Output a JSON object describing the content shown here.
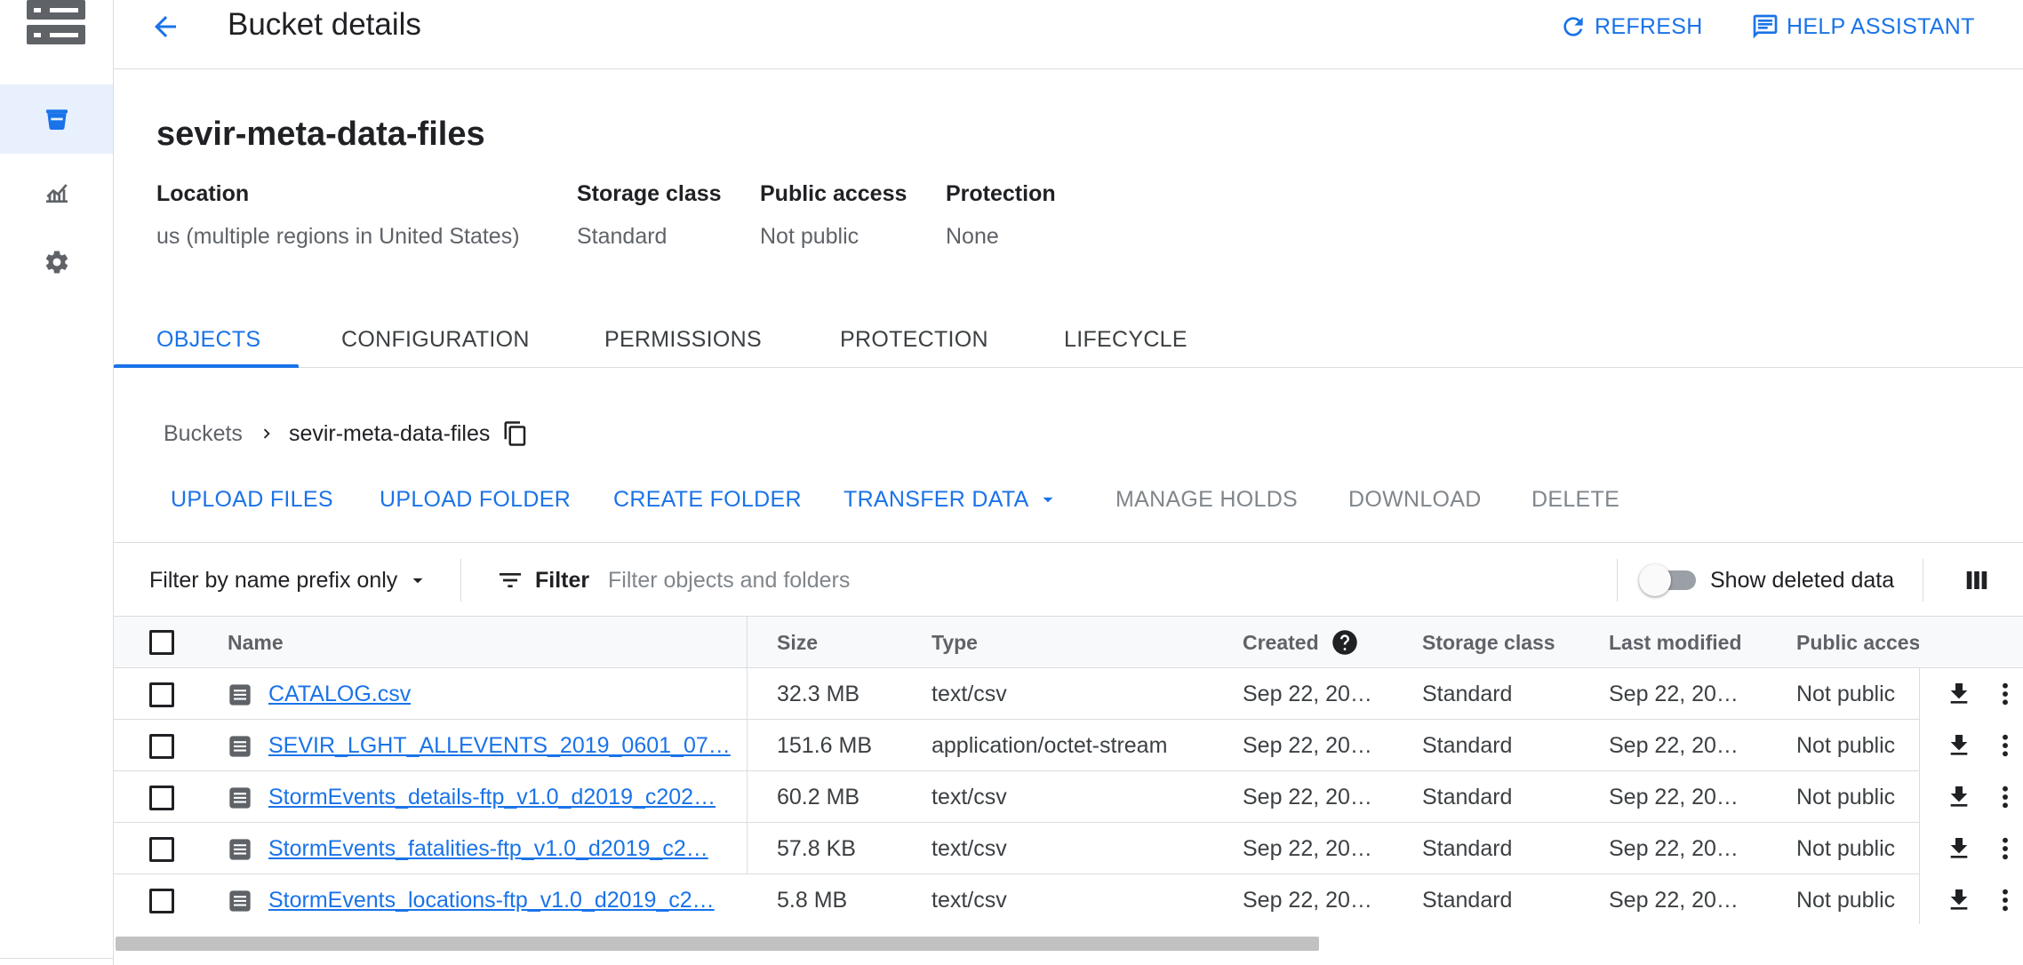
{
  "header": {
    "title": "Bucket details",
    "refresh_label": "REFRESH",
    "help_label": "HELP ASSISTANT"
  },
  "bucket": {
    "name": "sevir-meta-data-files",
    "meta": [
      {
        "label": "Location",
        "value": "us (multiple regions in United States)"
      },
      {
        "label": "Storage class",
        "value": "Standard"
      },
      {
        "label": "Public access",
        "value": "Not public"
      },
      {
        "label": "Protection",
        "value": "None"
      }
    ]
  },
  "tabs": [
    {
      "label": "OBJECTS",
      "active": true
    },
    {
      "label": "CONFIGURATION"
    },
    {
      "label": "PERMISSIONS"
    },
    {
      "label": "PROTECTION"
    },
    {
      "label": "LIFECYCLE"
    }
  ],
  "breadcrumb": {
    "root": "Buckets",
    "current": "sevir-meta-data-files"
  },
  "actions": {
    "upload_files": "UPLOAD FILES",
    "upload_folder": "UPLOAD FOLDER",
    "create_folder": "CREATE FOLDER",
    "transfer_data": "TRANSFER DATA",
    "manage_holds": "MANAGE HOLDS",
    "download": "DOWNLOAD",
    "delete": "DELETE"
  },
  "filter": {
    "prefix_mode": "Filter by name prefix only",
    "filter_label": "Filter",
    "placeholder": "Filter objects and folders",
    "show_deleted_label": "Show deleted data",
    "show_deleted_on": false
  },
  "table": {
    "columns": {
      "name": "Name",
      "size": "Size",
      "type": "Type",
      "created": "Created",
      "storage_class": "Storage class",
      "last_modified": "Last modified",
      "public_access": "Public access"
    },
    "rows": [
      {
        "name": "CATALOG.csv",
        "size": "32.3 MB",
        "type": "text/csv",
        "created": "Sep 22, 20…",
        "storage_class": "Standard",
        "last_modified": "Sep 22, 20…",
        "public_access": "Not public"
      },
      {
        "name": "SEVIR_LGHT_ALLEVENTS_2019_0601_07…",
        "size": "151.6 MB",
        "type": "application/octet-stream",
        "created": "Sep 22, 20…",
        "storage_class": "Standard",
        "last_modified": "Sep 22, 20…",
        "public_access": "Not public"
      },
      {
        "name": "StormEvents_details-ftp_v1.0_d2019_c202…",
        "size": "60.2 MB",
        "type": "text/csv",
        "created": "Sep 22, 20…",
        "storage_class": "Standard",
        "last_modified": "Sep 22, 20…",
        "public_access": "Not public"
      },
      {
        "name": "StormEvents_fatalities-ftp_v1.0_d2019_c2…",
        "size": "57.8 KB",
        "type": "text/csv",
        "created": "Sep 22, 20…",
        "storage_class": "Standard",
        "last_modified": "Sep 22, 20…",
        "public_access": "Not public"
      },
      {
        "name": "StormEvents_locations-ftp_v1.0_d2019_c2…",
        "size": "5.8 MB",
        "type": "text/csv",
        "created": "Sep 22, 20…",
        "storage_class": "Standard",
        "last_modified": "Sep 22, 20…",
        "public_access": "Not public"
      }
    ]
  },
  "icons": {
    "rail": [
      "storage-logo-icon",
      "bucket-icon",
      "monitoring-icon",
      "settings-icon"
    ],
    "header": [
      "back-arrow-icon",
      "refresh-icon",
      "help-assistant-icon"
    ],
    "row": [
      "file-icon",
      "download-icon",
      "more-vert-icon"
    ]
  },
  "colors": {
    "accent": "#1a73e8",
    "rail_active_bg": "#e8f0fe",
    "divider": "#dadce0",
    "muted_text": "#5f6368",
    "disabled_text": "#80868b"
  }
}
